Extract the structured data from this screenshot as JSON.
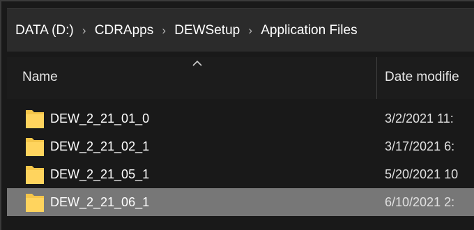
{
  "breadcrumb": {
    "items": [
      {
        "label": "DATA (D:)"
      },
      {
        "label": "CDRApps"
      },
      {
        "label": "DEWSetup"
      },
      {
        "label": "Application Files"
      }
    ],
    "separator": "›"
  },
  "columns": {
    "name": "Name",
    "date_modified": "Date modifie",
    "sort_icon": "chevron-up-icon"
  },
  "files": [
    {
      "name": "DEW_2_21_01_0",
      "date": "3/2/2021 11:",
      "icon": "folder-icon",
      "selected": false
    },
    {
      "name": "DEW_2_21_02_1",
      "date": "3/17/2021 6:",
      "icon": "folder-icon",
      "selected": false
    },
    {
      "name": "DEW_2_21_05_1",
      "date": "5/20/2021 10",
      "icon": "folder-icon",
      "selected": false
    },
    {
      "name": "DEW_2_21_06_1",
      "date": "6/10/2021 2:",
      "icon": "folder-icon",
      "selected": true
    }
  ],
  "colors": {
    "background": "#191919",
    "address_bar": "#2b2b2b",
    "selected_row": "#777777",
    "folder": "#f5c64a"
  }
}
